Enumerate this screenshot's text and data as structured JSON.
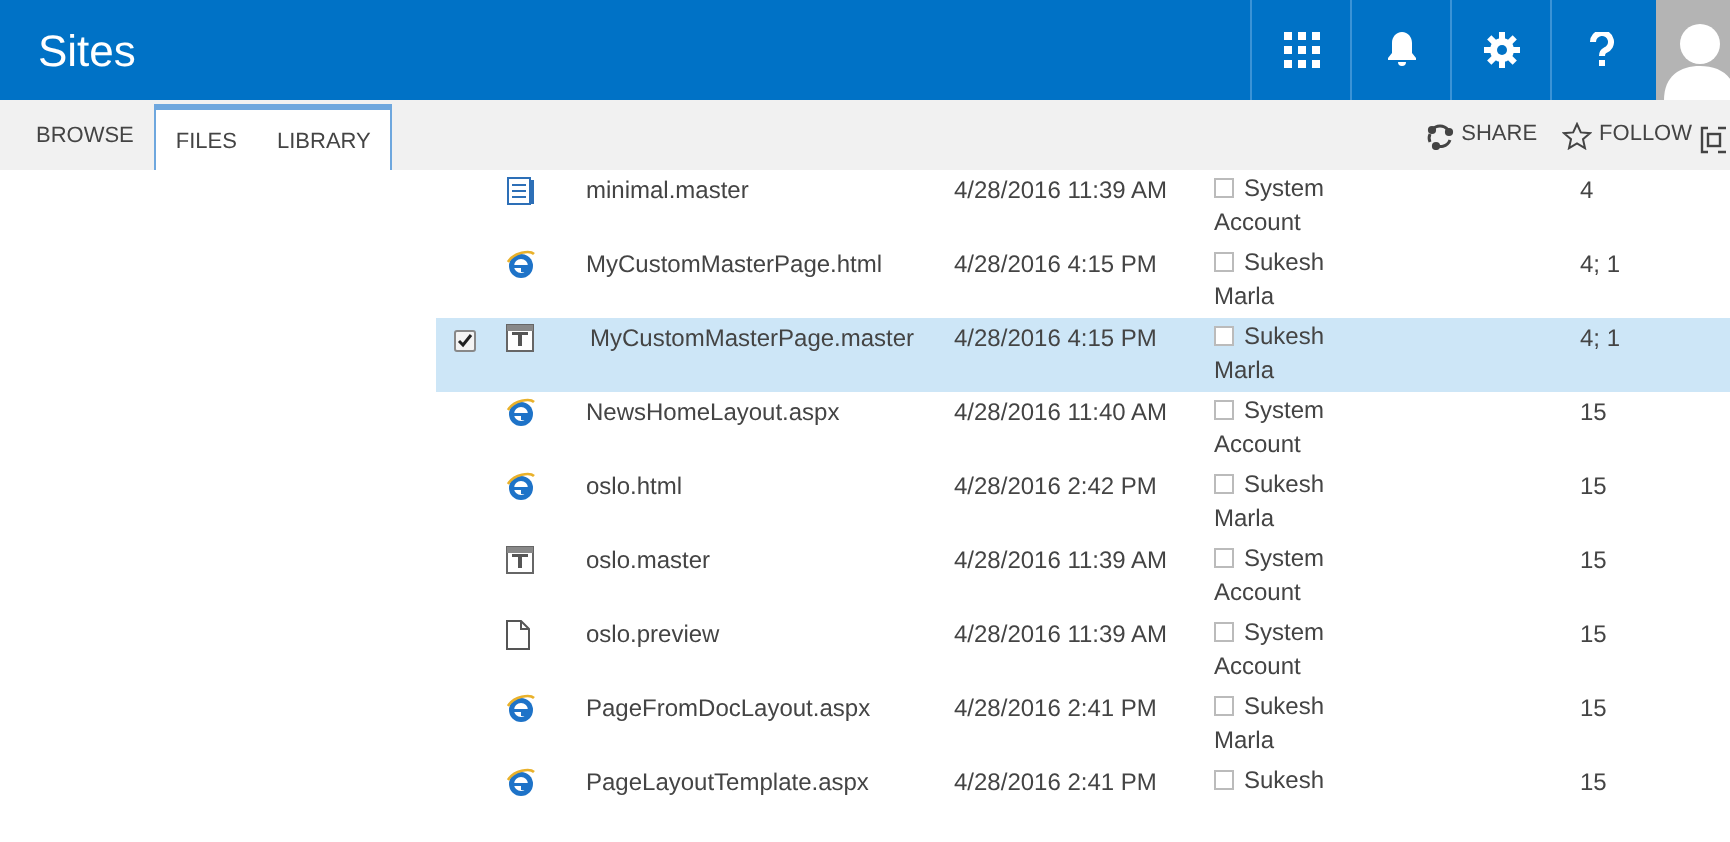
{
  "header": {
    "title": "Sites"
  },
  "ribbon": {
    "tabs": [
      {
        "label": "BROWSE",
        "selected": false
      },
      {
        "label": "FILES",
        "selected": true
      },
      {
        "label": "LIBRARY",
        "selected": true
      }
    ],
    "actions": [
      {
        "label": "SHARE",
        "kind": "share"
      },
      {
        "label": "FOLLOW",
        "kind": "follow"
      }
    ]
  },
  "rows": [
    {
      "kind": "page",
      "name": "minimal.master",
      "modified": "4/28/2016 11:39 AM",
      "author": "System Account",
      "column_5": "4",
      "selected": false
    },
    {
      "kind": "web",
      "name": "MyCustomMasterPage.html",
      "modified": "4/28/2016 4:15 PM",
      "author": "Sukesh Marla",
      "column_5": "4; 1",
      "selected": false
    },
    {
      "kind": "master",
      "name": "MyCustomMasterPage.master",
      "modified": "4/28/2016 4:15 PM",
      "author": "Sukesh Marla",
      "column_5": "4; 1",
      "selected": true
    },
    {
      "kind": "web",
      "name": "NewsHomeLayout.aspx",
      "modified": "4/28/2016 11:40 AM",
      "author": "System Account",
      "column_5": "15",
      "selected": false
    },
    {
      "kind": "web",
      "name": "oslo.html",
      "modified": "4/28/2016 2:42 PM",
      "author": "Sukesh Marla",
      "column_5": "15",
      "selected": false
    },
    {
      "kind": "master",
      "name": "oslo.master",
      "modified": "4/28/2016 11:39 AM",
      "author": "System Account",
      "column_5": "15",
      "selected": false
    },
    {
      "kind": "file",
      "name": "oslo.preview",
      "modified": "4/28/2016 11:39 AM",
      "author": "System Account",
      "column_5": "15",
      "selected": false
    },
    {
      "kind": "web",
      "name": "PageFromDocLayout.aspx",
      "modified": "4/28/2016 2:41 PM",
      "author": "Sukesh Marla",
      "column_5": "15",
      "selected": false
    },
    {
      "kind": "web",
      "name": "PageLayoutTemplate.aspx",
      "modified": "4/28/2016 2:41 PM",
      "author": "Sukesh",
      "column_5": "15",
      "selected": false
    }
  ]
}
